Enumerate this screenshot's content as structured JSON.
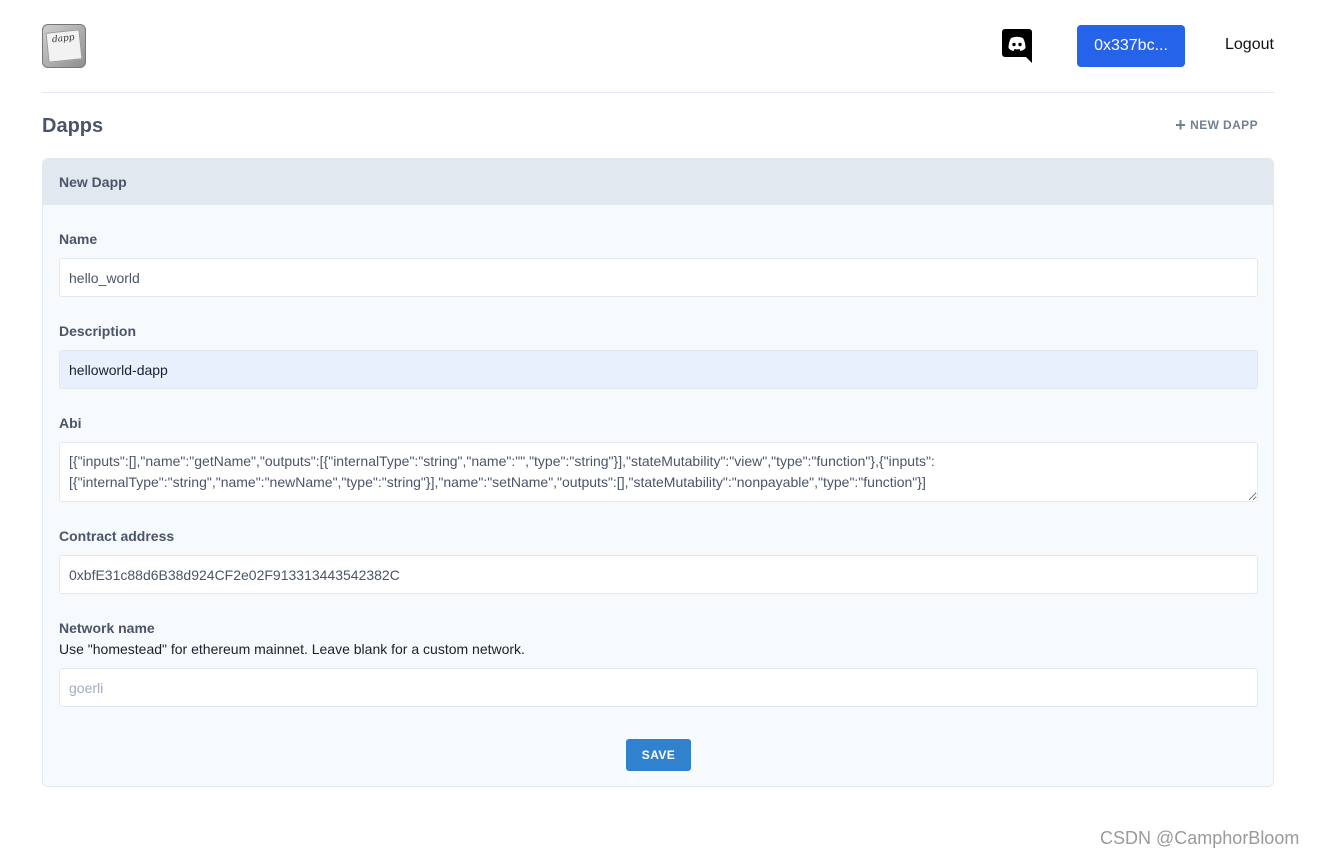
{
  "header": {
    "logo_icon": "dapp-logo-icon",
    "logo_text": "dapp",
    "discord_icon": "discord-icon",
    "wallet_label": "0x337bc...",
    "logout_label": "Logout"
  },
  "page": {
    "title": "Dapps",
    "new_dapp_icon": "plus-icon",
    "new_dapp_label": "NEW DAPP"
  },
  "form": {
    "title": "New Dapp",
    "name": {
      "label": "Name",
      "value": "hello_world"
    },
    "description": {
      "label": "Description",
      "value": "helloworld-dapp"
    },
    "abi": {
      "label": "Abi",
      "value": "[{\"inputs\":[],\"name\":\"getName\",\"outputs\":[{\"internalType\":\"string\",\"name\":\"\",\"type\":\"string\"}],\"stateMutability\":\"view\",\"type\":\"function\"},{\"inputs\":[{\"internalType\":\"string\",\"name\":\"newName\",\"type\":\"string\"}],\"name\":\"setName\",\"outputs\":[],\"stateMutability\":\"nonpayable\",\"type\":\"function\"}]"
    },
    "contract_address": {
      "label": "Contract address",
      "value": "0xbfE31c88d6B38d924CF2e02F913313443542382C"
    },
    "network_name": {
      "label": "Network name",
      "help": "Use \"homestead\" for ethereum mainnet. Leave blank for a custom network.",
      "placeholder": "goerli"
    },
    "save_label": "SAVE"
  },
  "watermark": "CSDN @CamphorBloom",
  "colors": {
    "accent": "#2563eb",
    "save_button": "#3182ce",
    "card_header": "#e2e8f0",
    "card_body": "#f7fafc"
  }
}
